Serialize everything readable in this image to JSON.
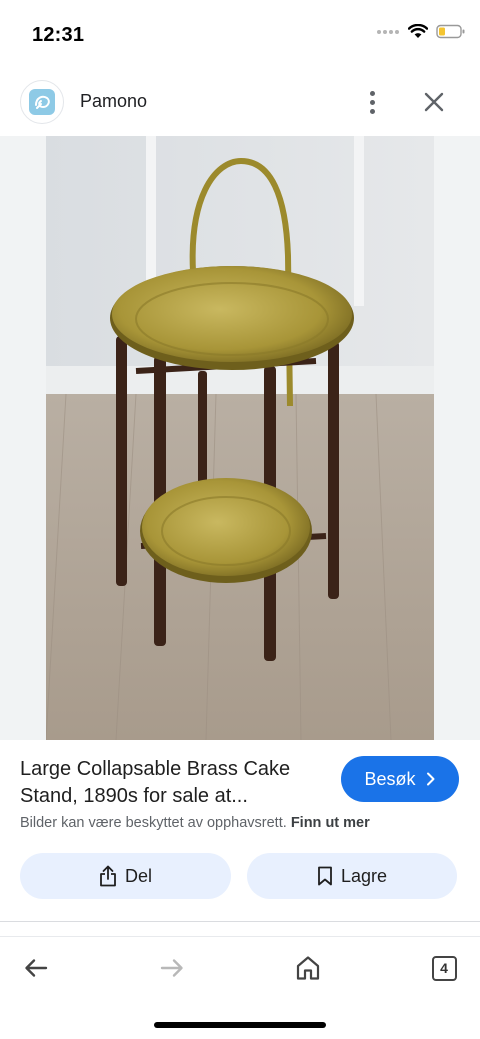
{
  "status": {
    "time": "12:31"
  },
  "header": {
    "site_name": "Pamono",
    "logo_icon": "pamono-logo-icon",
    "menu_icon": "more-vert-icon",
    "close_icon": "close-icon"
  },
  "result": {
    "title": "Large Collapsable Brass Cake Stand, 1890s for sale at...",
    "visit_label": "Besøk",
    "copyright_text": "Bilder kan være beskyttet av opphavsrett.",
    "learn_more": "Finn ut mer"
  },
  "actions": {
    "share_label": "Del",
    "save_label": "Lagre"
  },
  "nav": {
    "tab_count": "4"
  },
  "colors": {
    "accent": "#1a73e8",
    "chip_bg": "#e8f0fe",
    "image_bg": "#f1f3f4"
  }
}
